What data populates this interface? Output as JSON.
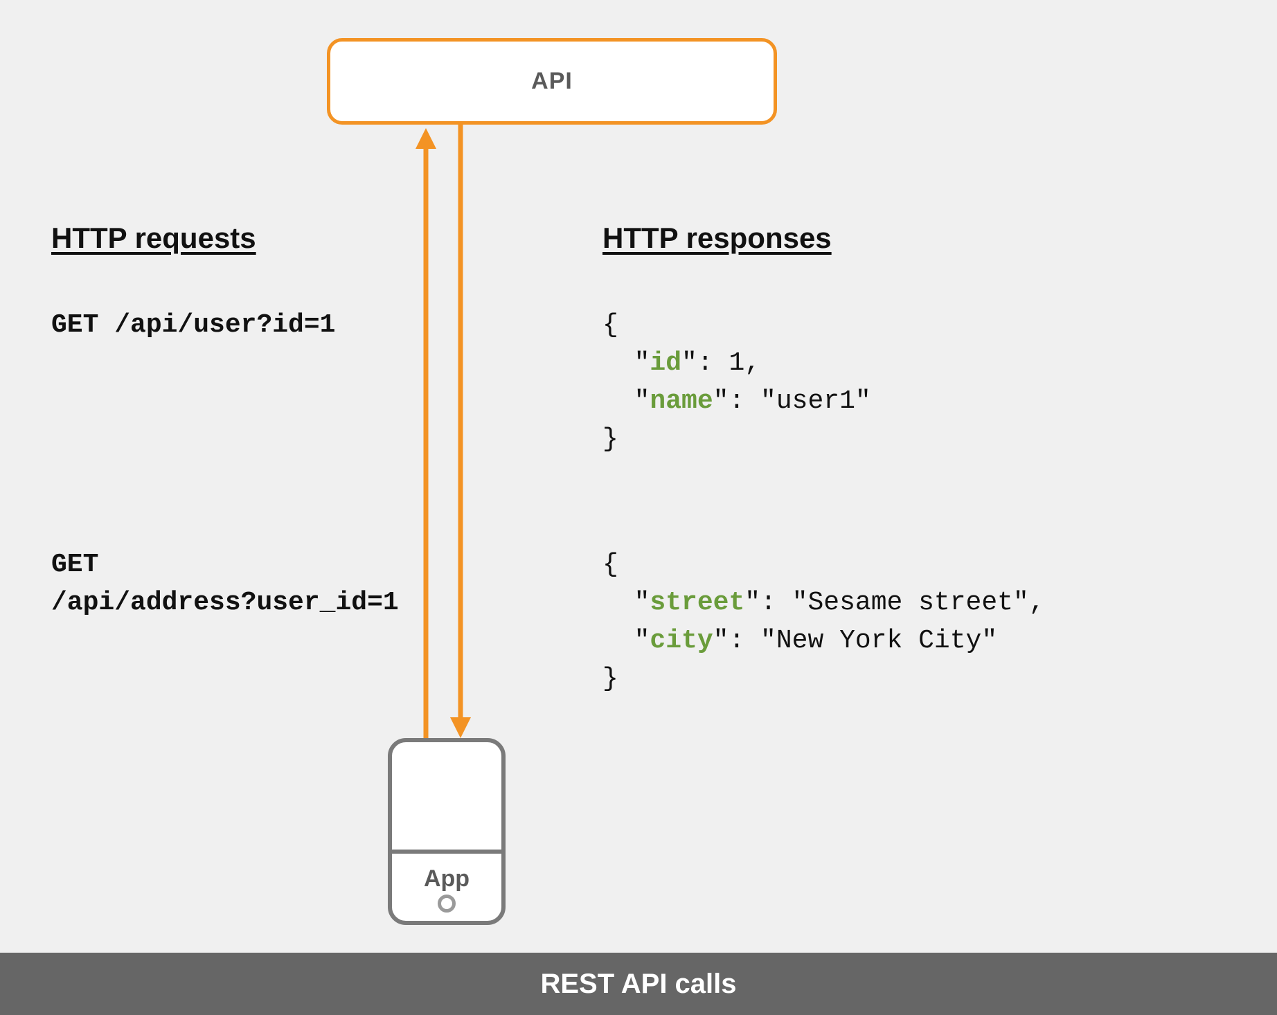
{
  "api_box": {
    "label": "API"
  },
  "phone": {
    "label": "App"
  },
  "headings": {
    "requests": "HTTP requests",
    "responses": "HTTP responses"
  },
  "requests": {
    "r1": "GET /api/user?id=1",
    "r2_line1": "GET",
    "r2_line2": "/api/address?user_id=1"
  },
  "responses": {
    "resp1": {
      "open": "{",
      "k1": "id",
      "v1": ": 1,",
      "k2": "name",
      "v2": ": \"user1\"",
      "close": "}"
    },
    "resp2": {
      "open": "{",
      "k1": "street",
      "v1": ": \"Sesame street\",",
      "k2": "city",
      "v2": ": \"New York City\"",
      "close": "}"
    }
  },
  "footer": {
    "title": "REST API calls"
  },
  "colors": {
    "accent": "#f39324",
    "gray": "#7a7a7a",
    "key_green": "#6a9c3b",
    "footer_bg": "#666666"
  }
}
